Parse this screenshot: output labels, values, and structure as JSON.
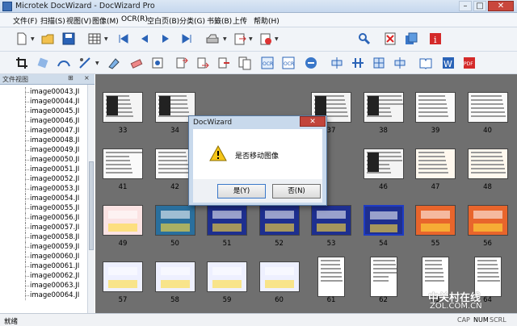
{
  "window": {
    "title": "Microtek DocWizard - DocWizard Pro"
  },
  "menu": {
    "items": [
      "文件(F)",
      "扫描(S)",
      "视图(V)",
      "图像(M)",
      "OCR(R)",
      "空白页(B)",
      "分类(G)",
      "书籤(B)",
      "上传",
      "帮助(H)"
    ]
  },
  "panel": {
    "title": "文件视图",
    "pin": "▾ ✕",
    "pin_icon": "⊞",
    "close_icon": "×",
    "tree": [
      "image00043.JI",
      "image00044.JI",
      "image00045.JI",
      "image00046.JI",
      "image00047.JI",
      "image00048.JI",
      "image00049.JI",
      "image00050.JI",
      "image00051.JI",
      "image00052.JI",
      "image00053.JI",
      "image00054.JI",
      "image00055.JI",
      "image00056.JI",
      "image00057.JI",
      "image00058.JI",
      "image00059.JI",
      "image00060.JI",
      "image00061.JI",
      "image00062.JI",
      "image00063.JI",
      "image00064.JI"
    ]
  },
  "thumbnails": [
    {
      "num": "33",
      "style": "doc-dark"
    },
    {
      "num": "34",
      "style": "doc-dark"
    },
    {
      "num": "",
      "style": "hidden"
    },
    {
      "num": "",
      "style": "hidden"
    },
    {
      "num": "37",
      "style": "doc-dark"
    },
    {
      "num": "38",
      "style": "doc-dark"
    },
    {
      "num": "39",
      "style": "doc"
    },
    {
      "num": "40",
      "style": "doc"
    },
    {
      "num": "41",
      "style": "doc"
    },
    {
      "num": "42",
      "style": "doc"
    },
    {
      "num": "",
      "style": "hidden"
    },
    {
      "num": "",
      "style": "hidden"
    },
    {
      "num": "",
      "style": "hidden"
    },
    {
      "num": "46",
      "style": "doc-dark"
    },
    {
      "num": "47",
      "style": "doc-color"
    },
    {
      "num": "48",
      "style": "doc-color"
    },
    {
      "num": "49",
      "style": "color-red"
    },
    {
      "num": "50",
      "style": "color-teal"
    },
    {
      "num": "51",
      "style": "color-blue"
    },
    {
      "num": "52",
      "style": "color-blue"
    },
    {
      "num": "53",
      "style": "color-blue"
    },
    {
      "num": "54",
      "style": "color-blue",
      "selected": true
    },
    {
      "num": "55",
      "style": "color-orange"
    },
    {
      "num": "56",
      "style": "color-orange"
    },
    {
      "num": "57",
      "style": "color-light"
    },
    {
      "num": "58",
      "style": "color-light"
    },
    {
      "num": "59",
      "style": "color-light"
    },
    {
      "num": "60",
      "style": "color-light"
    },
    {
      "num": "61",
      "style": "portrait"
    },
    {
      "num": "62",
      "style": "portrait"
    },
    {
      "num": "63",
      "style": "portrait"
    },
    {
      "num": "64",
      "style": "portrait"
    }
  ],
  "dialog": {
    "title": "DocWizard",
    "close": "✕",
    "message": "是否移动图像",
    "yes": "是(Y)",
    "no": "否(N)"
  },
  "status": {
    "left": "就绪",
    "cap": "CAP",
    "num": "NUM",
    "scrl": "SCRL"
  },
  "watermark": {
    "brand": "中关村在线",
    "sub": "ZOL.COM.CN"
  },
  "colors": {
    "accent": "#1e3bc4",
    "background": "#6f6f6f"
  }
}
